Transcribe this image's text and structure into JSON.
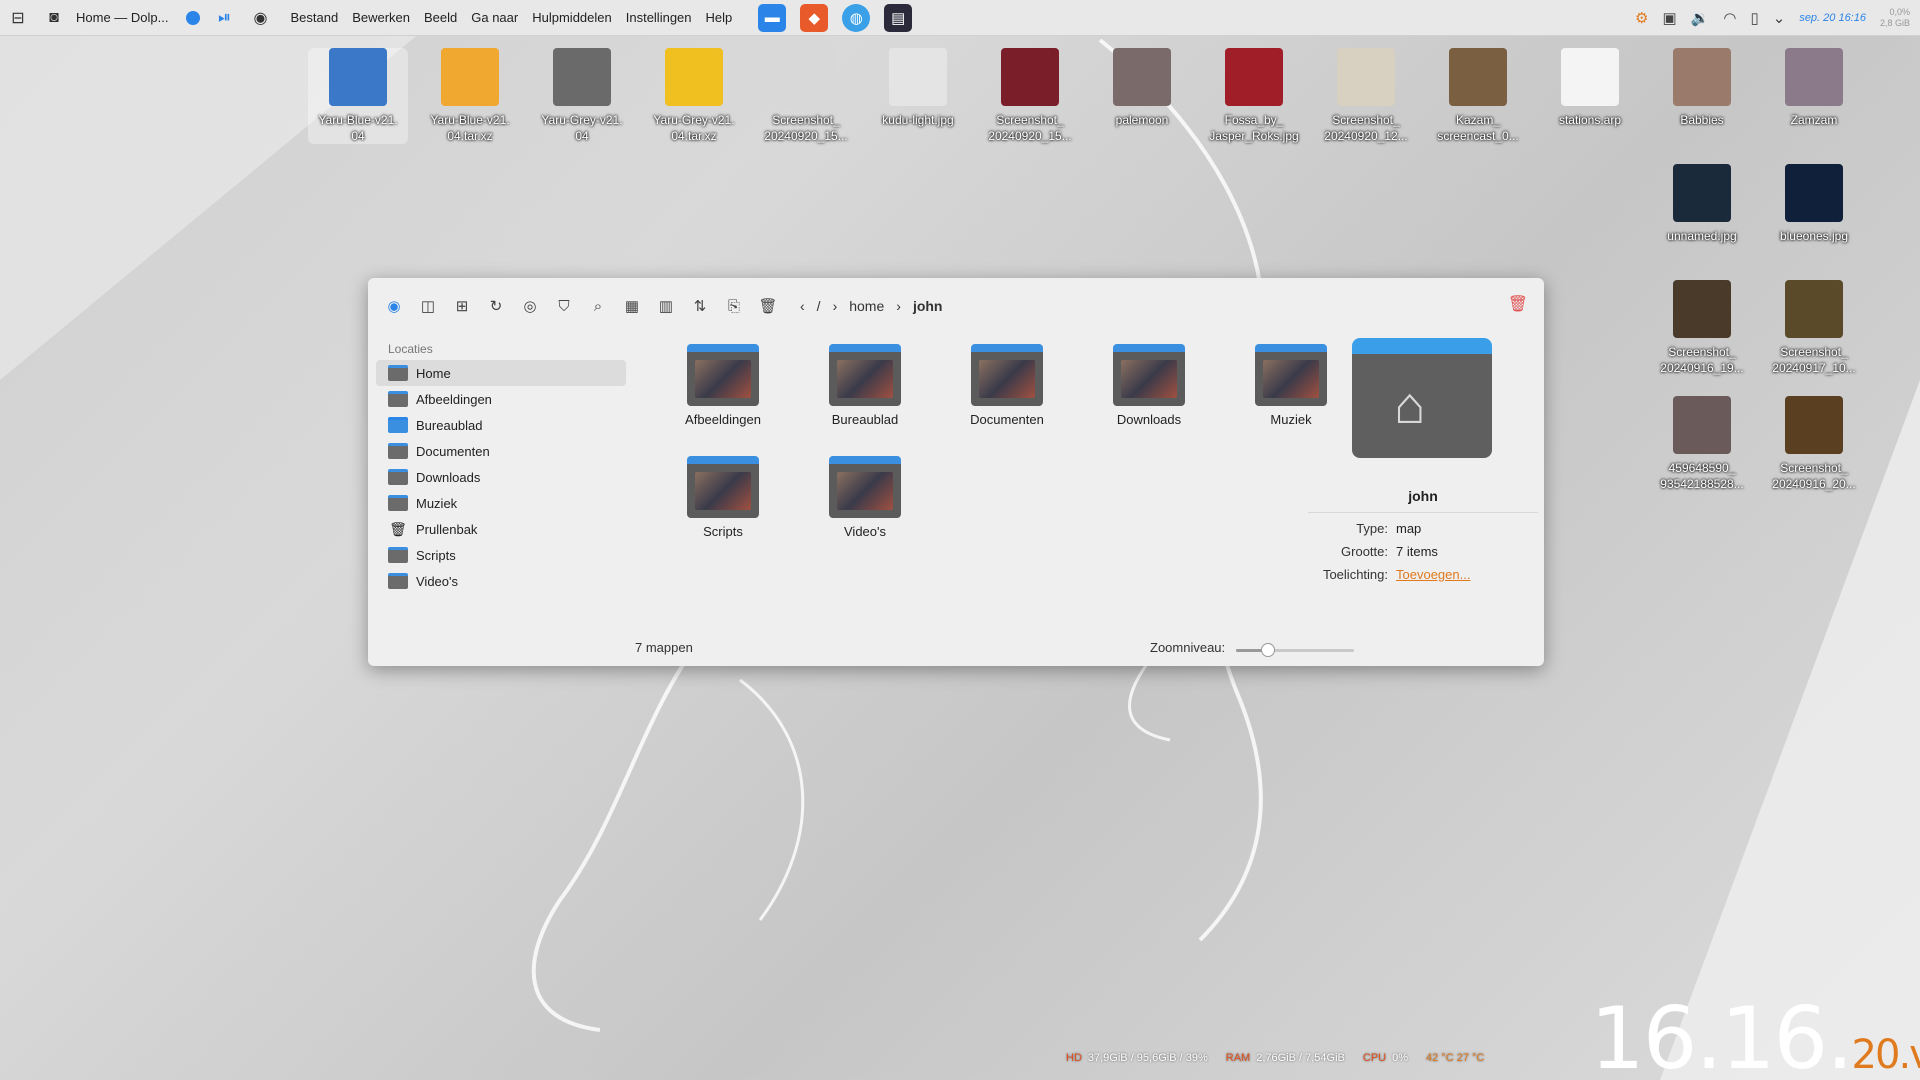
{
  "window_title": "Home — Dolp...",
  "menu": [
    "Bestand",
    "Bewerken",
    "Beeld",
    "Ga naar",
    "Hulpmiddelen",
    "Instellingen",
    "Help"
  ],
  "clock_top": "sep. 20 16:16",
  "tray_mini": [
    "0,0%",
    "2,8 GiB"
  ],
  "desktop_icons": [
    {
      "label": "Yaru-Blue-v21.\n04",
      "selected": true,
      "color": "#3c78c8"
    },
    {
      "label": "Yaru-Blue-v21.\n04.tar.xz",
      "color": "#f0a830"
    },
    {
      "label": "Yaru-Grey-v21.\n04",
      "color": "#6a6a6a"
    },
    {
      "label": "Yaru-Grey-v21.\n04.tar.xz",
      "color": "#f0c020"
    },
    {
      "label": "Screenshot_\n20240920_15...",
      "color": "#d8d8d8"
    },
    {
      "label": "kudu-light.jpg",
      "color": "#e4e4e4"
    },
    {
      "label": "Screenshot_\n20240920_15...",
      "color": "#7a1e2a"
    },
    {
      "label": "palemoon",
      "color": "#7a6a6a"
    },
    {
      "label": "Fossa_by_\nJasper_Roks.jpg",
      "color": "#a01e28"
    },
    {
      "label": "Screenshot_\n20240920_12...",
      "color": "#d8d0c0"
    },
    {
      "label": "Kazam_\nscreencast_0...",
      "color": "#7a6040"
    },
    {
      "label": "stations.arp",
      "color": "#f4f4f4"
    },
    {
      "label": "Babbies",
      "color": "#9a7a6a"
    },
    {
      "label": "Zamzam",
      "color": "#8a7a8a"
    },
    {
      "label": "unnamed.jpg",
      "color": "#1a2a3a"
    },
    {
      "label": "blueones.jpg",
      "color": "#10203a"
    },
    {
      "label": "Screenshot_\n20240916_19...",
      "color": "#4a3a2a"
    },
    {
      "label": "Screenshot_\n20240917_10...",
      "color": "#5a4a2a"
    },
    {
      "label": "459648590_\n93542188528...",
      "color": "#6a5a5a"
    },
    {
      "label": "Screenshot_\n20240916_20...",
      "color": "#5a4020"
    }
  ],
  "dolphin": {
    "breadcrumb": {
      "root": "/",
      "parts": [
        "home",
        "john"
      ]
    },
    "sidebar": {
      "heading": "Locaties",
      "items": [
        {
          "label": "Home",
          "active": true,
          "icon": "folder-icon"
        },
        {
          "label": "Afbeeldingen",
          "icon": "folder-icon"
        },
        {
          "label": "Bureaublad",
          "icon": "folder-blue-icon"
        },
        {
          "label": "Documenten",
          "icon": "folder-icon"
        },
        {
          "label": "Downloads",
          "icon": "folder-icon"
        },
        {
          "label": "Muziek",
          "icon": "folder-icon"
        },
        {
          "label": "Prullenbak",
          "icon": "trash-icon"
        },
        {
          "label": "Scripts",
          "icon": "folder-icon"
        },
        {
          "label": "Video's",
          "icon": "folder-icon"
        }
      ]
    },
    "folders": [
      "Afbeeldingen",
      "Bureaublad",
      "Documenten",
      "Downloads",
      "Muziek",
      "Scripts",
      "Video's"
    ],
    "status": {
      "count": "7 mappen",
      "zoom_label": "Zoomniveau:",
      "zoom_fraction": 0.27
    },
    "info": {
      "name": "john",
      "rows": [
        {
          "key": "Type:",
          "value": "map"
        },
        {
          "key": "Grootte:",
          "value": "7 items"
        },
        {
          "key": "Toelichting:",
          "value": "Toevoegen..."
        }
      ]
    }
  },
  "sysmon": {
    "hd_label": "HD",
    "hd_value": "37,9GiB / 95,6GiB / 39%",
    "ram_label": "RAM",
    "ram_value": "2,76GiB / 7,54GiB",
    "cpu_label": "CPU",
    "cpu_value": "0%",
    "temp": "42 °C 27 °C"
  },
  "big_clock": {
    "time": "16.16.",
    "seconds": "20.",
    "suffix": "vr"
  }
}
